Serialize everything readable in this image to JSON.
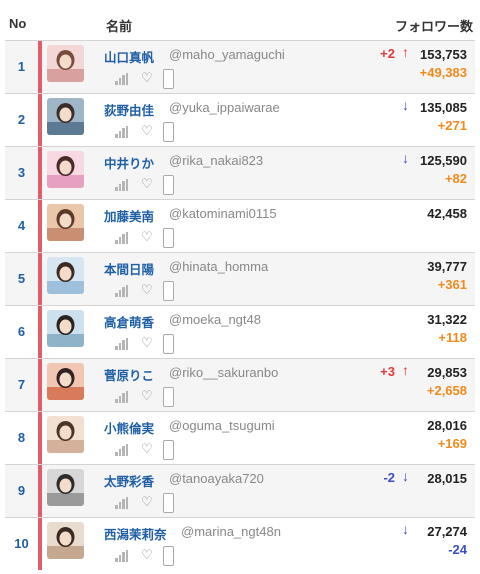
{
  "header": {
    "no": "No",
    "name": "名前",
    "followers": "フォロワー数"
  },
  "colors": {
    "accent_bar": "#e25d6a",
    "rank_blue": "#1f5fa6",
    "up_red": "#e03a3a",
    "down_blue": "#3b4ec2",
    "gain_orange": "#f08a1c"
  },
  "rows": [
    {
      "rank": "1",
      "name": "山口真帆",
      "handle": "@maho_yamaguchi",
      "rank_change": "+2",
      "rank_dir": "up",
      "followers": "153,753",
      "gain": "+49,383"
    },
    {
      "rank": "2",
      "name": "荻野由佳",
      "handle": "@yuka_ippaiwarae",
      "rank_change": "",
      "rank_dir": "down",
      "followers": "135,085",
      "gain": "+271"
    },
    {
      "rank": "3",
      "name": "中井りか",
      "handle": "@rika_nakai823",
      "rank_change": "",
      "rank_dir": "down",
      "followers": "125,590",
      "gain": "+82"
    },
    {
      "rank": "4",
      "name": "加藤美南",
      "handle": "@katominami0115",
      "rank_change": "",
      "rank_dir": "",
      "followers": "42,458",
      "gain": ""
    },
    {
      "rank": "5",
      "name": "本間日陽",
      "handle": "@hinata_homma",
      "rank_change": "",
      "rank_dir": "",
      "followers": "39,777",
      "gain": "+361"
    },
    {
      "rank": "6",
      "name": "高倉萌香",
      "handle": "@moeka_ngt48",
      "rank_change": "",
      "rank_dir": "",
      "followers": "31,322",
      "gain": "+118"
    },
    {
      "rank": "7",
      "name": "菅原りこ",
      "handle": "@riko__sakuranbo",
      "rank_change": "+3",
      "rank_dir": "up",
      "followers": "29,853",
      "gain": "+2,658"
    },
    {
      "rank": "8",
      "name": "小熊倫実",
      "handle": "@oguma_tsugumi",
      "rank_change": "",
      "rank_dir": "",
      "followers": "28,016",
      "gain": "+169"
    },
    {
      "rank": "9",
      "name": "太野彩香",
      "handle": "@tanoayaka720",
      "rank_change": "-2",
      "rank_dir": "down",
      "followers": "28,015",
      "gain": ""
    },
    {
      "rank": "10",
      "name": "西潟茉莉奈",
      "handle": "@marina_ngt48n",
      "rank_change": "",
      "rank_dir": "down",
      "followers": "27,274",
      "gain": "-24"
    }
  ]
}
